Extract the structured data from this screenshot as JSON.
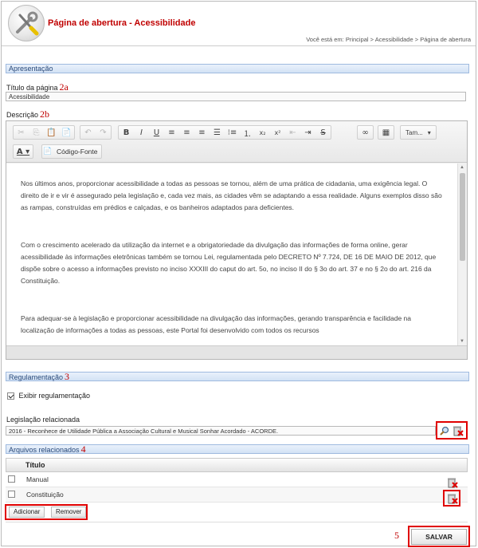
{
  "header": {
    "title": "Página de abertura - Acessibilidade",
    "breadcrumb": "Você está em: Principal > Acessibilidade > Página de abertura"
  },
  "sections": {
    "apresentacao": "Apresentação",
    "regulamentacao": "Regulamentação",
    "arquivos": "Arquivos relacionados"
  },
  "annotations": {
    "a2a": "2a",
    "a2b": "2b",
    "a3": "3",
    "a4": "4",
    "a5": "5"
  },
  "form": {
    "titulo_label": "Título da página",
    "titulo_value": "Acessibilidade",
    "descricao_label": "Descrição"
  },
  "editor": {
    "toolbar": {
      "tamanho_label": "Tam...",
      "codigo_fonte_label": "Código-Fonte",
      "subscript_label": "x₂",
      "superscript_label": "x²"
    },
    "paragraphs": [
      "Nos últimos anos, proporcionar acessibilidade a todas as pessoas se tornou, além de uma prática de cidadania, uma exigência legal. O direito de ir e vir é assegurado pela legislação e, cada vez mais, as cidades vêm se adaptando a essa realidade. Alguns exemplos disso são as rampas, construídas em prédios e calçadas, e os banheiros adaptados para deficientes.",
      "Com o crescimento acelerado da utilização da internet e a obrigatoriedade da divulgação das informações de forma online, gerar acessibilidade às informações eletrônicas também se tornou Lei, regulamentada pelo DECRETO Nº 7.724, DE 16 DE MAIO DE 2012, que dispõe sobre o acesso a informações previsto no inciso XXXIII do caput do art. 5o, no inciso II do § 3o do art. 37 e no § 2o do art. 216 da Constituição.",
      "Para adequar-se à legislação e proporcionar acessibilidade na divulgação das informações, gerando transparência e facilidade na localização de informações a todas as pessoas, este Portal foi desenvolvido com todos os recursos"
    ]
  },
  "regulamentacao": {
    "exibir_label": "Exibir regulamentação",
    "legislacao_label": "Legislação relacionada",
    "legislacao_value": "2016 - Reconhece de Utilidade Pública a Associação Cultural e Musical Sonhar Acordado - ACORDE."
  },
  "arquivos": {
    "column_title": "Título",
    "rows": [
      {
        "title": "Manual"
      },
      {
        "title": "Constituição"
      }
    ],
    "adicionar_label": "Adicionar",
    "remover_label": "Remover"
  },
  "save_label": "SALVAR",
  "colors": {
    "accent_red": "#c00000",
    "highlight": "#e00000",
    "section_bg": "#d3e2f5"
  },
  "icons": [
    "tools-logo-icon",
    "search-icon",
    "delete-icon",
    "cut-icon",
    "copy-icon",
    "paste-icon",
    "undo-icon",
    "redo-icon",
    "table-icon",
    "link-icon"
  ]
}
